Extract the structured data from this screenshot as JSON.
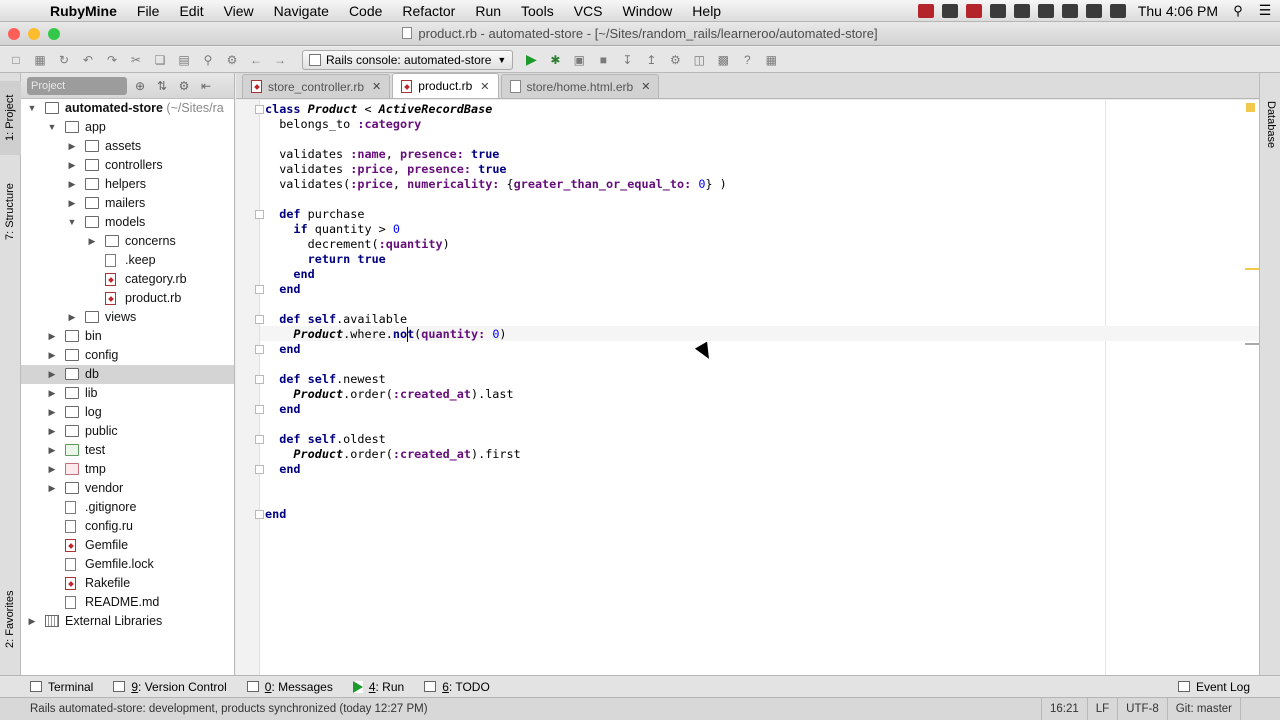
{
  "menubar": {
    "app_name": "RubyMine",
    "items": [
      "File",
      "Edit",
      "View",
      "Navigate",
      "Code",
      "Refactor",
      "Run",
      "Tools",
      "VCS",
      "Window",
      "Help"
    ],
    "clock": "Thu 4:06 PM"
  },
  "window": {
    "title": "product.rb - automated-store - [~/Sites/random_rails/learneroo/automated-store]"
  },
  "toolbar": {
    "run_config": "Rails console: automated-store"
  },
  "left_stripe": {
    "project_tab": "1: Project",
    "structure_tab": "7: Structure",
    "favorites_tab": "2: Favorites"
  },
  "right_stripe": {
    "database_tab": "Database"
  },
  "project_panel": {
    "view_label": "Project"
  },
  "tree": {
    "rows": [
      {
        "label": "automated-store",
        "hint": " (~/Sites/ra",
        "bold": true
      },
      {
        "label": "app"
      },
      {
        "label": "assets"
      },
      {
        "label": "controllers"
      },
      {
        "label": "helpers"
      },
      {
        "label": "mailers"
      },
      {
        "label": "models"
      },
      {
        "label": "concerns"
      },
      {
        "label": ".keep"
      },
      {
        "label": "category.rb"
      },
      {
        "label": "product.rb"
      },
      {
        "label": "views"
      },
      {
        "label": "bin"
      },
      {
        "label": "config"
      },
      {
        "label": "db"
      },
      {
        "label": "lib"
      },
      {
        "label": "log"
      },
      {
        "label": "public"
      },
      {
        "label": "test"
      },
      {
        "label": "tmp"
      },
      {
        "label": "vendor"
      },
      {
        "label": ".gitignore"
      },
      {
        "label": "config.ru"
      },
      {
        "label": "Gemfile"
      },
      {
        "label": "Gemfile.lock"
      },
      {
        "label": "Rakefile"
      },
      {
        "label": "README.md"
      },
      {
        "label": "External Libraries"
      }
    ]
  },
  "editor_tabs": [
    {
      "label": "store_controller.rb",
      "active": false
    },
    {
      "label": "product.rb",
      "active": true
    },
    {
      "label": "store/home.html.erb",
      "active": false
    }
  ],
  "code": {
    "lines": [
      "class Product < ActiveRecord::Base",
      "  belongs_to :category",
      "",
      "  validates :name, presence: true",
      "  validates :price, presence: true",
      "  validates(:price, numericality: {greater_than_or_equal_to: 0} )",
      "",
      "  def purchase",
      "    if quantity > 0",
      "      decrement(:quantity)",
      "      return true",
      "    end",
      "  end",
      "",
      "  def self.available",
      "    Product.where.not(quantity: 0)",
      "  end",
      "",
      "  def self.newest",
      "    Product.order(:created_at).last",
      "  end",
      "",
      "  def self.oldest",
      "    Product.order(:created_at).first",
      "  end",
      "",
      "",
      "end"
    ]
  },
  "tool_windows": [
    {
      "label": "Terminal",
      "mnemonic": ""
    },
    {
      "label": ": Version Control",
      "mnemonic": "9"
    },
    {
      "label": ": Messages",
      "mnemonic": "0"
    },
    {
      "label": ": Run",
      "mnemonic": "4"
    },
    {
      "label": ": TODO",
      "mnemonic": "6"
    }
  ],
  "event_log": "Event Log",
  "status": {
    "message": "Rails automated-store: development, products synchronized (today 12:27 PM)",
    "position": "16:21",
    "line_sep": "LF",
    "encoding": "UTF-8",
    "vcs": "Git: master"
  },
  "colors": {
    "selection": "#d4d4d4",
    "keyword": "#000080",
    "symbol": "#660e7a",
    "number": "#0000ff"
  }
}
